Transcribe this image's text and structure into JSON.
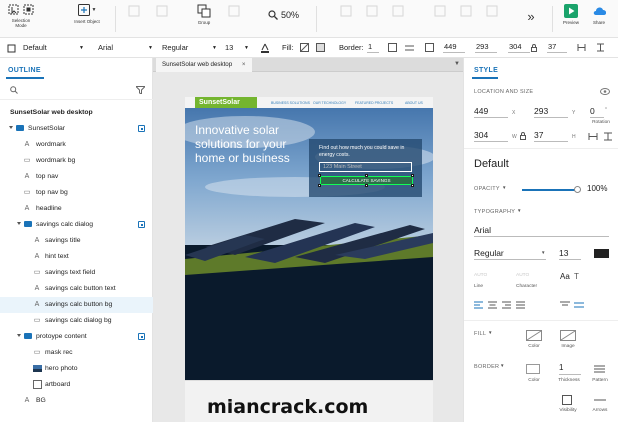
{
  "toolbar": {
    "selection_mode": "Selection Mode",
    "insert_object": "Insert Object",
    "group": "Group",
    "zoom": "50%",
    "preview": "Preview",
    "share": "Share"
  },
  "propbar": {
    "style": "Default",
    "font": "Arial",
    "weight": "Regular",
    "size": "13",
    "fill_label": "Fill:",
    "border_label": "Border:",
    "border_width": "1",
    "x": "449",
    "y": "293",
    "w": "304",
    "h": "37"
  },
  "outline": {
    "title": "OUTLINE",
    "items": [
      {
        "label": "SunsetSolar web desktop"
      },
      {
        "label": "SunsetSolar"
      },
      {
        "label": "wordmark"
      },
      {
        "label": "wordmark bg"
      },
      {
        "label": "top nav"
      },
      {
        "label": "top nav bg"
      },
      {
        "label": "headline"
      },
      {
        "label": "savings calc dialog"
      },
      {
        "label": "savings title"
      },
      {
        "label": "hint text"
      },
      {
        "label": "savings text field"
      },
      {
        "label": "savings calc button text"
      },
      {
        "label": "savings calc button bg"
      },
      {
        "label": "savings calc dialog bg"
      },
      {
        "label": "protoype content"
      },
      {
        "label": "mask rec"
      },
      {
        "label": "hero photo"
      },
      {
        "label": "artboard"
      },
      {
        "label": "BG"
      }
    ]
  },
  "canvas": {
    "tab": "SunsetSolar web desktop",
    "logo": "SunsetSolar",
    "nav_links": [
      "BUSINESS SOLUTIONS",
      "OUR TECHNOLOGY",
      "FEATURED PROJECTS",
      "ABOUT US"
    ],
    "headline": "Innovative solar solutions for your home or business",
    "hint": "Find out how much you could save in energy costs.",
    "field_placeholder": "123 Main Street",
    "button": "CALCULATE SAVINGS"
  },
  "style_panel": {
    "title": "STYLE",
    "location_title": "LOCATION AND SIZE",
    "x": "449",
    "y": "293",
    "w": "304",
    "h": "37",
    "rotation": "0",
    "rotation_label": "Rotation",
    "style_name": "Default",
    "opacity_label": "OPACITY",
    "opacity": 1.0,
    "opacity_text": "100%",
    "typography_label": "TYPOGRAPHY",
    "font": "Arial",
    "weight": "Regular",
    "size": "13",
    "line_label": "Line",
    "char_label": "Character",
    "auto1": "AUTO",
    "auto2": "AUTO",
    "fill_label": "FILL",
    "color_label": "Color",
    "image_label": "Image",
    "border_label": "BORDER",
    "border_width": "1",
    "thickness_label": "Thickness",
    "pattern_label": "Pattern",
    "visibility_label": "Visibility",
    "arrows_label": "Arrows"
  },
  "watermark": "miancrack.com",
  "colors": {
    "accent": "#1a73b8",
    "logo_green": "#74b52f",
    "preview_green": "#1aa36b",
    "share_blue": "#2a8ae5"
  }
}
